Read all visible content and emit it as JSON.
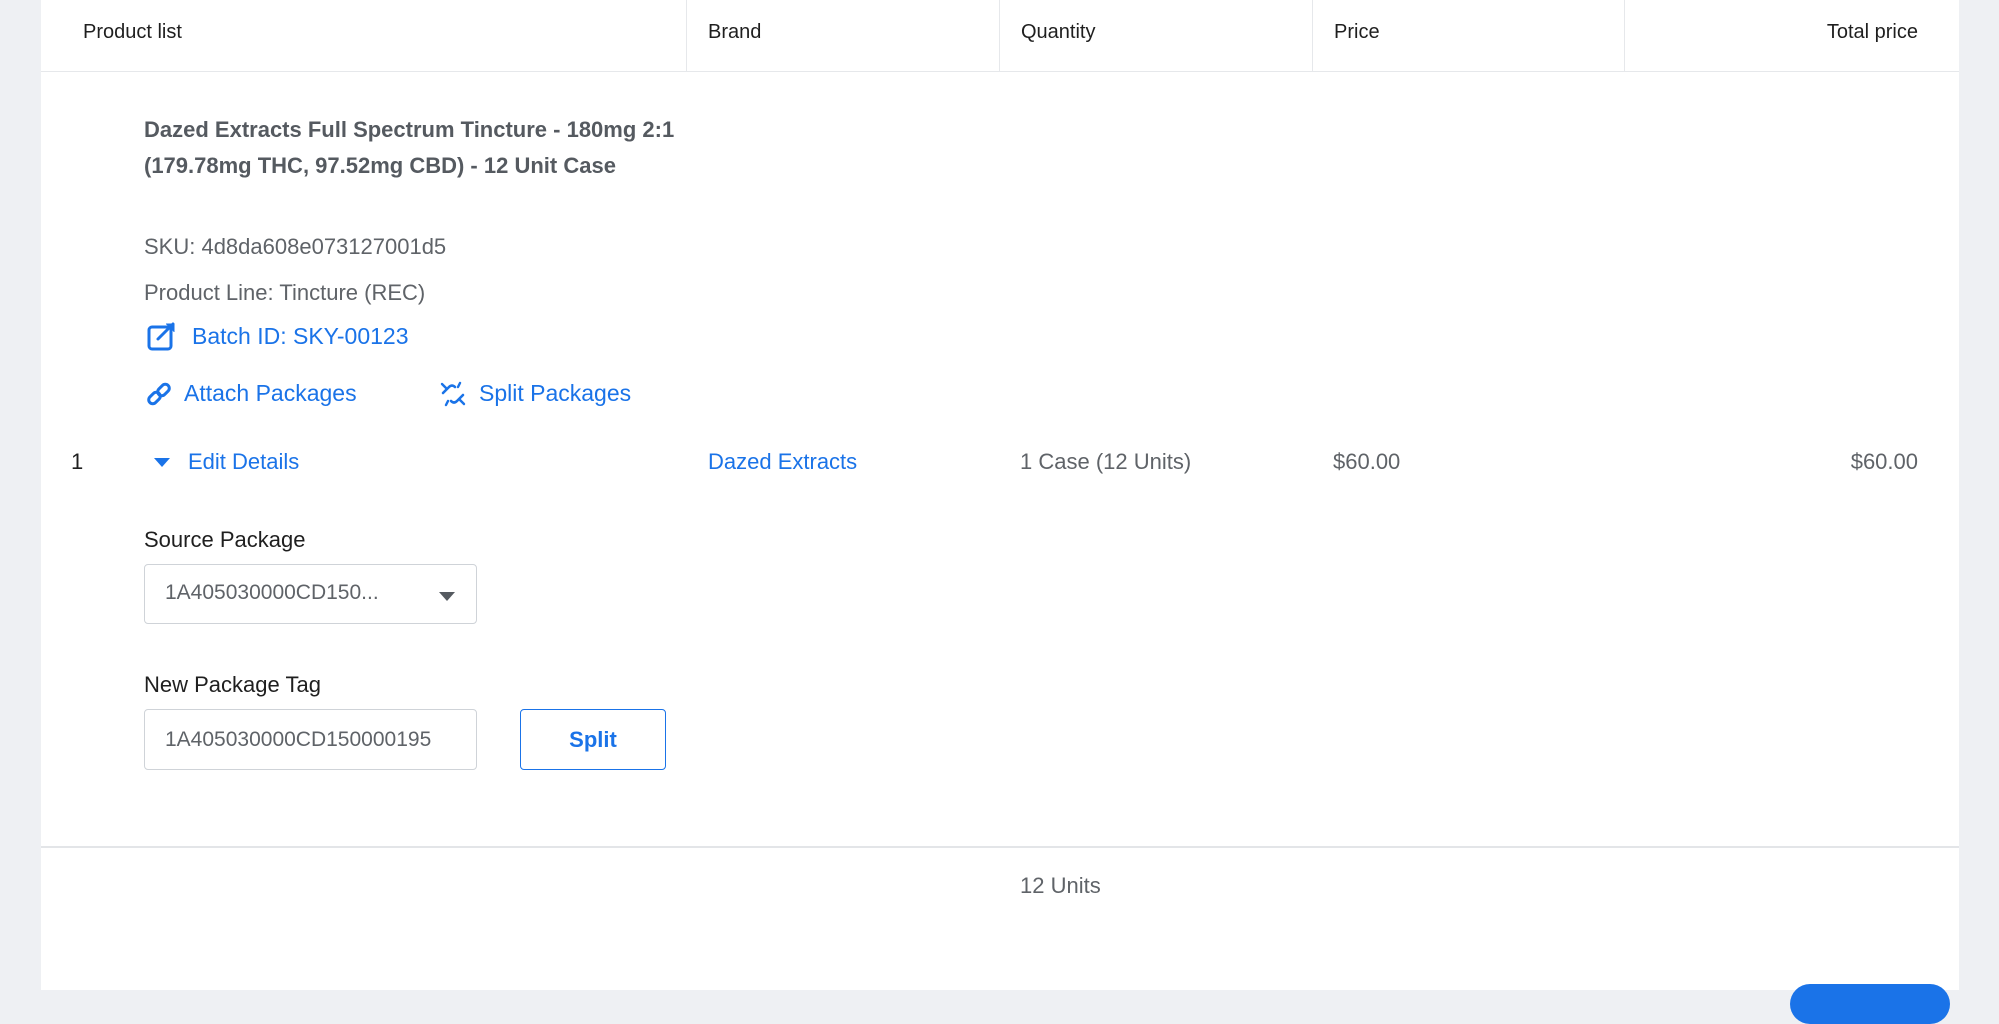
{
  "table": {
    "headers": {
      "product_list": "Product list",
      "brand": "Brand",
      "quantity": "Quantity",
      "price": "Price",
      "total_price": "Total price"
    }
  },
  "item": {
    "index": "1",
    "product_name": "Dazed Extracts Full Spectrum Tincture - 180mg 2:1 (179.78mg THC, 97.52mg CBD) - 12 Unit Case",
    "sku": "SKU: 4d8da608e073127001d5",
    "product_line": "Product Line: Tincture (REC)",
    "batch_id": "Batch ID: SKY-00123",
    "attach_packages": "Attach Packages",
    "split_packages": "Split Packages",
    "edit_details": "Edit Details",
    "brand": "Dazed Extracts",
    "quantity": "1 Case (12 Units)",
    "price": "$60.00",
    "total_price": "$60.00"
  },
  "details": {
    "source_package_label": "Source Package",
    "source_package_value": "1A405030000CD150...",
    "new_package_tag_label": "New Package Tag",
    "new_package_tag_value": "1A405030000CD150000195",
    "split_button": "Split"
  },
  "footer": {
    "total_units": "12 Units"
  },
  "colors": {
    "accent": "#1a73e8",
    "text": "#1f1f1f",
    "muted": "#5f6368",
    "border": "#cfd3d8",
    "background": "#eef0f3"
  }
}
